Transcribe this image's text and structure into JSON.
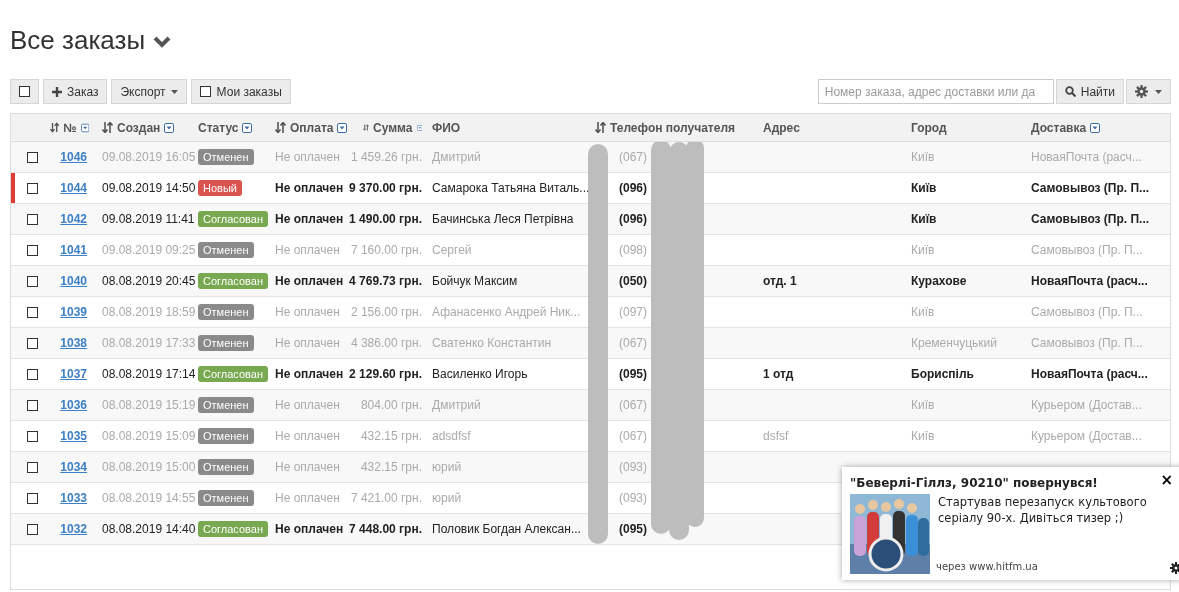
{
  "title": "Все заказы",
  "toolbar": {
    "select_all": {
      "checked": false
    },
    "add_button": "Заказ",
    "export_button": "Экспорт",
    "my_orders": {
      "label": "Мои заказы",
      "checked": false
    },
    "search": {
      "placeholder": "Номер заказа, адрес доставки или да"
    },
    "search_button": "Найти"
  },
  "table": {
    "columns": [
      {
        "label": "№",
        "sortable": true,
        "filter": true
      },
      {
        "label": "Создан",
        "sortable": true,
        "filter": true
      },
      {
        "label": "Статус",
        "sortable": false,
        "filter": true
      },
      {
        "label": "Оплата",
        "sortable": true,
        "filter": true
      },
      {
        "label": "Сумма",
        "sortable": true,
        "filter": true
      },
      {
        "label": "ФИО",
        "sortable": false,
        "filter": false
      },
      {
        "label": "Телефон получателя",
        "sortable": true,
        "filter": false
      },
      {
        "label": "Адрес",
        "sortable": false,
        "filter": false
      },
      {
        "label": "Город",
        "sortable": false,
        "filter": false
      },
      {
        "label": "Доставка",
        "sortable": false,
        "filter": true
      }
    ],
    "rows": [
      {
        "checked": false,
        "highlighted": false,
        "muted": true,
        "number": "1046",
        "created": "09.08.2019 16:05",
        "status": {
          "kind": "cancelled",
          "label": "Отменен"
        },
        "payment": "Не оплачен",
        "sum": "1 459.26 грн.",
        "name": "Дмитрий",
        "phone": "(067)",
        "address": "",
        "city": "Київ",
        "delivery": "НоваяПочта (расч..."
      },
      {
        "checked": false,
        "highlighted": true,
        "muted": false,
        "number": "1044",
        "created": "09.08.2019 14:50",
        "status": {
          "kind": "new",
          "label": "Новый"
        },
        "payment": "Не оплачен",
        "sum": "9 370.00 грн.",
        "name": "Самарока Татьяна Виталь...",
        "phone": "(096)",
        "address": "",
        "city": "Київ",
        "delivery": "Самовывоз (Пр. П..."
      },
      {
        "checked": false,
        "highlighted": false,
        "muted": false,
        "number": "1042",
        "created": "09.08.2019 11:41",
        "status": {
          "kind": "approved",
          "label": "Согласован"
        },
        "payment": "Не оплачен",
        "sum": "1 490.00 грн.",
        "name": "Бачинська Леся Петрівна",
        "phone": "(096)",
        "address": "",
        "city": "Київ",
        "delivery": "Самовывоз (Пр. П..."
      },
      {
        "checked": false,
        "highlighted": false,
        "muted": true,
        "number": "1041",
        "created": "09.08.2019 09:25",
        "status": {
          "kind": "cancelled",
          "label": "Отменен"
        },
        "payment": "Не оплачен",
        "sum": "7 160.00 грн.",
        "name": "Сергей",
        "phone": "(098)",
        "address": "",
        "city": "Київ",
        "delivery": "Самовывоз (Пр. П..."
      },
      {
        "checked": false,
        "highlighted": false,
        "muted": false,
        "number": "1040",
        "created": "08.08.2019 20:45",
        "status": {
          "kind": "approved",
          "label": "Согласован"
        },
        "payment": "Не оплачен",
        "sum": "4 769.73 грн.",
        "name": "Бойчук Максим",
        "phone": "(050)",
        "address": "отд. 1",
        "city": "Курахове",
        "delivery": "НоваяПочта (расч..."
      },
      {
        "checked": false,
        "highlighted": false,
        "muted": true,
        "number": "1039",
        "created": "08.08.2019 18:59",
        "status": {
          "kind": "cancelled",
          "label": "Отменен"
        },
        "payment": "Не оплачен",
        "sum": "2 156.00 грн.",
        "name": "Афанасенко Андрей Ник...",
        "phone": "(097)",
        "address": "",
        "city": "Київ",
        "delivery": "Самовывоз (Пр. П..."
      },
      {
        "checked": false,
        "highlighted": false,
        "muted": true,
        "number": "1038",
        "created": "08.08.2019 17:33",
        "status": {
          "kind": "cancelled",
          "label": "Отменен"
        },
        "payment": "Не оплачен",
        "sum": "4 386.00 грн.",
        "name": "Сватенко Константин",
        "phone": "(067)",
        "address": "",
        "city": "Кременчуцький",
        "delivery": "Самовывоз (Пр. П..."
      },
      {
        "checked": false,
        "highlighted": false,
        "muted": false,
        "number": "1037",
        "created": "08.08.2019 17:14",
        "status": {
          "kind": "approved",
          "label": "Согласован"
        },
        "payment": "Не оплачен",
        "sum": "2 129.60 грн.",
        "name": "Василенко Игорь",
        "phone": "(095)",
        "address": "1 отд",
        "city": "Бориспіль",
        "delivery": "НоваяПочта (расч..."
      },
      {
        "checked": false,
        "highlighted": false,
        "muted": true,
        "number": "1036",
        "created": "08.08.2019 15:19",
        "status": {
          "kind": "cancelled",
          "label": "Отменен"
        },
        "payment": "Не оплачен",
        "sum": "804.00 грн.",
        "name": "Дмитрий",
        "phone": "(067)",
        "address": "",
        "city": "Київ",
        "delivery": "Курьером (Достав..."
      },
      {
        "checked": false,
        "highlighted": false,
        "muted": true,
        "number": "1035",
        "created": "08.08.2019 15:09",
        "status": {
          "kind": "cancelled",
          "label": "Отменен"
        },
        "payment": "Не оплачен",
        "sum": "432.15 грн.",
        "name": "adsdfsf",
        "phone": "(067)",
        "address": "dsfsf",
        "city": "Київ",
        "delivery": "Курьером (Достав..."
      },
      {
        "checked": false,
        "highlighted": false,
        "muted": true,
        "number": "1034",
        "created": "08.08.2019 15:00",
        "status": {
          "kind": "cancelled",
          "label": "Отменен"
        },
        "payment": "Не оплачен",
        "sum": "432.15 грн.",
        "name": "юрий",
        "phone": "(093)",
        "address": "",
        "city": "",
        "delivery": ""
      },
      {
        "checked": false,
        "highlighted": false,
        "muted": true,
        "number": "1033",
        "created": "08.08.2019 14:55",
        "status": {
          "kind": "cancelled",
          "label": "Отменен"
        },
        "payment": "Не оплачен",
        "sum": "7 421.00 грн.",
        "name": "юрий",
        "phone": "(093)",
        "address": "",
        "city": "",
        "delivery": ""
      },
      {
        "checked": false,
        "highlighted": false,
        "muted": false,
        "number": "1032",
        "created": "08.08.2019 14:40",
        "status": {
          "kind": "approved",
          "label": "Согласован"
        },
        "payment": "Не оплачен",
        "sum": "7 448.00 грн.",
        "name": "Половик Богдан Алексан...",
        "phone": "(095)",
        "address": "",
        "city": "",
        "delivery": ""
      }
    ]
  },
  "notification": {
    "title": "\"Беверлі-Гіллз, 90210\" повернувся!",
    "text": "Стартував перезапуск культового серіалу 90-х. Дивіться тизер ;)",
    "source": "через www.hitfm.ua",
    "close": "×"
  }
}
